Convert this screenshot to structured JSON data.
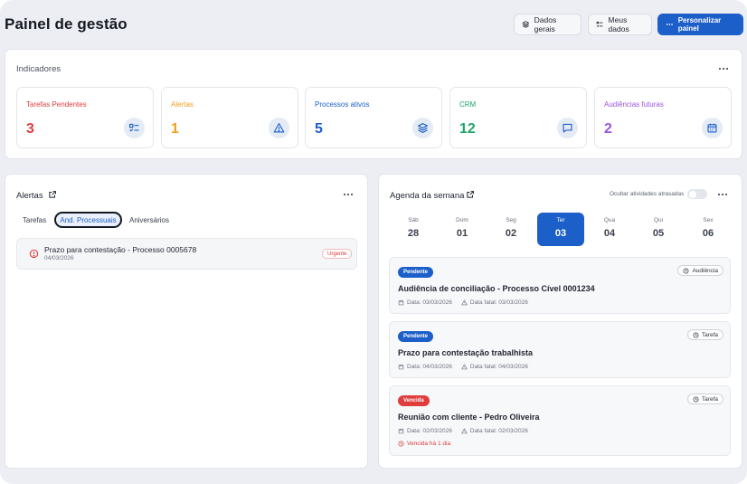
{
  "header": {
    "title": "Painel de gestão",
    "buttons": {
      "dados_gerais": "Dados gerais",
      "meus_dados": "Meus dados",
      "personalizar": "Personalizar painel"
    }
  },
  "indicators": {
    "title": "Indicadores",
    "items": [
      {
        "label": "Tarefas Pendentes",
        "value": "3",
        "color": "#e03d3d",
        "icon": "checklist-icon"
      },
      {
        "label": "Alertas",
        "value": "1",
        "color": "#f0a020",
        "icon": "warning-icon"
      },
      {
        "label": "Processos ativos",
        "value": "5",
        "color": "#1d5fc9",
        "icon": "layers-icon"
      },
      {
        "label": "CRM",
        "value": "12",
        "color": "#1fa56a",
        "icon": "message-icon"
      },
      {
        "label": "Audiências futuras",
        "value": "2",
        "color": "#9a55e0",
        "icon": "calendar-icon"
      }
    ]
  },
  "alerts": {
    "title": "Alertas",
    "tabs": [
      "Tarefas",
      "And. Processuais",
      "Aniversários"
    ],
    "active_tab": "And. Processuais",
    "items": [
      {
        "title": "Prazo para contestação - Processo 0005678",
        "date": "04/03/2026",
        "badge": "Urgente"
      }
    ]
  },
  "agenda": {
    "title": "Agenda da semana",
    "toggle_label": "Ocultar atividades atrasadas",
    "toggle_on": false,
    "days": [
      {
        "name": "Sáb",
        "num": "28"
      },
      {
        "name": "Dom",
        "num": "01"
      },
      {
        "name": "Seg",
        "num": "02"
      },
      {
        "name": "Ter",
        "num": "03"
      },
      {
        "name": "Qua",
        "num": "04"
      },
      {
        "name": "Qui",
        "num": "05"
      },
      {
        "name": "Sex",
        "num": "06"
      }
    ],
    "active_day": "03",
    "events": [
      {
        "status": "Pendente",
        "status_color": "#1d5fc9",
        "type": "Audiência",
        "title": "Audiência de conciliação - Processo Cível 0001234",
        "data": "Data: 03/03/2026",
        "data_fatal": "Data fatal: 03/03/2026",
        "note": ""
      },
      {
        "status": "Pendente",
        "status_color": "#1d5fc9",
        "type": "Tarefa",
        "title": "Prazo para contestação trabalhista",
        "data": "Data: 04/03/2026",
        "data_fatal": "Data fatal: 04/03/2026",
        "note": ""
      },
      {
        "status": "Vencida",
        "status_color": "#e03d3d",
        "type": "Tarefa",
        "title": "Reunião com cliente - Pedro Oliveira",
        "data": "Data: 02/03/2026",
        "data_fatal": "Data fatal: 02/03/2026",
        "note": "Vencida há 1 dia"
      }
    ]
  }
}
